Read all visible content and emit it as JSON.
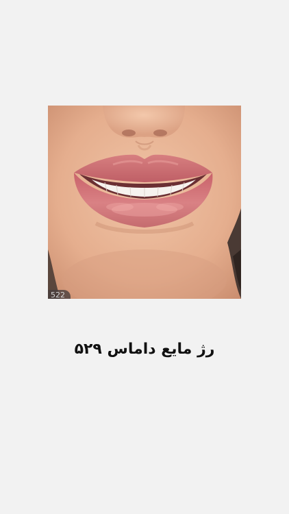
{
  "product": {
    "image_description_icon": "lips-photo",
    "badge_text": "522",
    "caption": "رژ مایع داماس ۵۲۹"
  },
  "colors": {
    "background": "#f2f2f2",
    "skin": "#e6b191",
    "lip": "#c9686e",
    "caption_text": "#111111"
  }
}
